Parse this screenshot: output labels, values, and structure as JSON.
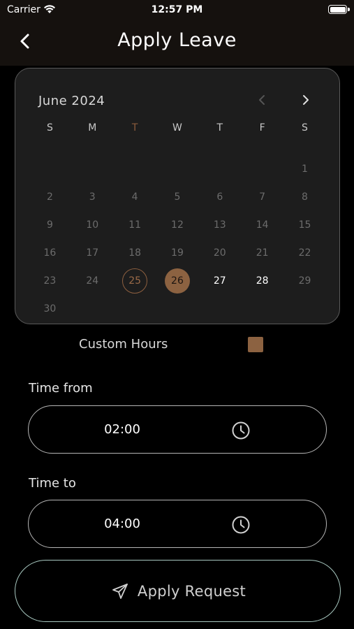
{
  "status_bar": {
    "carrier": "Carrier",
    "time": "12:57 PM"
  },
  "nav": {
    "title": "Apply Leave",
    "back_icon": "chevron-left-icon"
  },
  "calendar": {
    "month_label": "June 2024",
    "weekdays": [
      "S",
      "M",
      "T",
      "W",
      "T",
      "F",
      "S"
    ],
    "highlighted_weekday_index": 2,
    "weeks": [
      [
        "",
        "",
        "",
        "",
        "",
        "",
        "1"
      ],
      [
        "2",
        "3",
        "4",
        "5",
        "6",
        "7",
        "8"
      ],
      [
        "9",
        "10",
        "11",
        "12",
        "13",
        "14",
        "15"
      ],
      [
        "16",
        "17",
        "18",
        "19",
        "20",
        "21",
        "22"
      ],
      [
        "23",
        "24",
        "25",
        "26",
        "27",
        "28",
        "29"
      ],
      [
        "30",
        "",
        "",
        "",
        "",
        "",
        ""
      ]
    ],
    "today": "25",
    "selected": "26",
    "enabled_days": [
      "27",
      "28"
    ],
    "accent_color": "#8c6241"
  },
  "custom_hours": {
    "label": "Custom Hours",
    "checked": true
  },
  "time_from": {
    "label": "Time from",
    "value": "02:00",
    "icon": "clock-icon"
  },
  "time_to": {
    "label": "Time to",
    "value": "04:00",
    "icon": "clock-icon"
  },
  "apply_button": {
    "label": "Apply Request",
    "icon": "send-icon"
  }
}
